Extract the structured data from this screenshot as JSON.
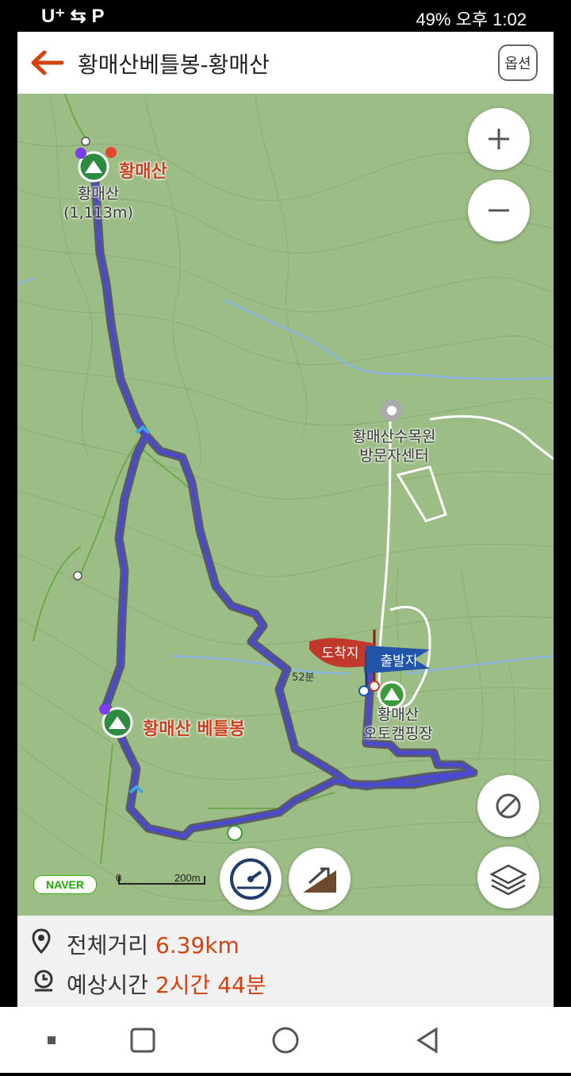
{
  "status_bar": {
    "left": "U⁺ ⇆ P",
    "right": "49% 오후 1:02"
  },
  "header": {
    "title": "황매산베틀봉-황매산",
    "options_label": "옵션"
  },
  "map": {
    "peaks": [
      {
        "name": "황매산",
        "elevation_label": "황매산\n(1,113m)"
      },
      {
        "name": "황매산 베틀봉"
      }
    ],
    "pois": [
      {
        "name": "황매산수목원\n방문자센터"
      },
      {
        "name": "황매산\n오토캠핑장"
      }
    ],
    "flags": {
      "arrival": "도착지",
      "departure": "출발지"
    },
    "time_marker": "52분",
    "logo": "NAVER",
    "scale": {
      "zero": "0",
      "distance": "200m"
    },
    "route_color": "#4a4ad0",
    "accent_color": "#d6420f"
  },
  "summary": {
    "distance_label": "전체거리",
    "distance_value": "6.39km",
    "time_label": "예상시간",
    "time_value": "2시간 44분"
  }
}
